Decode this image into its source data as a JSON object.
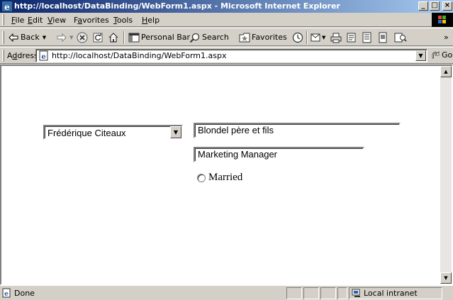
{
  "window": {
    "title": "http://localhost/DataBinding/WebForm1.aspx - Microsoft Internet Explorer",
    "minimize": "_",
    "maximize": "□",
    "close": "×"
  },
  "menu": {
    "file_pre": "",
    "file_key": "F",
    "file_post": "ile",
    "edit_pre": "",
    "edit_key": "E",
    "edit_post": "dit",
    "view_pre": "",
    "view_key": "V",
    "view_post": "iew",
    "favorites_pre": "F",
    "favorites_key": "a",
    "favorites_post": "vorites",
    "tools_pre": "",
    "tools_key": "T",
    "tools_post": "ools",
    "help_pre": "",
    "help_key": "H",
    "help_post": "elp"
  },
  "toolbar": {
    "back": "Back",
    "personal_bar": "Personal Bar",
    "search": "Search",
    "favorites": "Favorites",
    "overflow": "»"
  },
  "address": {
    "label_pre": "A",
    "label_key": "d",
    "label_post": "dress",
    "url": "http://localhost/DataBinding/WebForm1.aspx",
    "go": "Go"
  },
  "form": {
    "contact_name": "Frédérique Citeaux",
    "company_name": "Blondel père et fils",
    "contact_title": "Marketing Manager",
    "married_label": "Married"
  },
  "status": {
    "text": "Done",
    "zone": "Local intranet"
  },
  "icons": {
    "window": "ie-logo-icon",
    "throbber": "windows-flag-icon",
    "page": "page-icon",
    "stop": "stop-icon",
    "refresh": "refresh-icon",
    "home": "home-icon",
    "history": "history-icon",
    "mail": "mail-icon",
    "print": "print-icon",
    "edit": "edit-icon",
    "discuss": "discuss-icon",
    "messenger": "messenger-icon",
    "zone": "local-intranet-icon"
  }
}
